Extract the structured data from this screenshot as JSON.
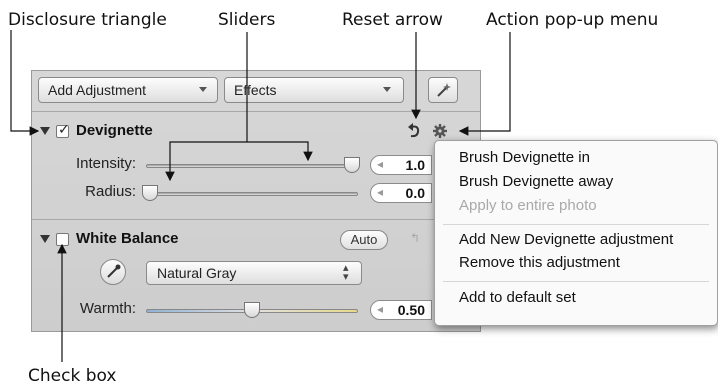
{
  "callouts": {
    "disclosure_triangle": "Disclosure triangle",
    "sliders": "Sliders",
    "reset_arrow": "Reset arrow",
    "action_popup_menu": "Action pop-up menu",
    "check_box": "Check box"
  },
  "toolbar": {
    "add_adjustment": "Add Adjustment",
    "effects": "Effects",
    "magic_icon": "wand-sparkle-icon"
  },
  "devignette": {
    "title": "Devignette",
    "checked": true,
    "intensity_label": "Intensity:",
    "intensity_value": "1.0",
    "intensity_level": 1.0,
    "radius_label": "Radius:",
    "radius_value": "0.0",
    "radius_level": 0.0,
    "reset_icon": "reset-arrow-icon",
    "action_icon": "gear-icon"
  },
  "white_balance": {
    "title": "White Balance",
    "checked": false,
    "auto_label": "Auto",
    "eyedropper_icon": "eyedropper-icon",
    "preset": "Natural Gray",
    "warmth_label": "Warmth:",
    "warmth_value": "0.50",
    "warmth_level": 0.5
  },
  "action_menu": {
    "items": [
      {
        "label": "Brush Devignette in",
        "enabled": true
      },
      {
        "label": "Brush Devignette away",
        "enabled": true
      },
      {
        "label": "Apply to entire photo",
        "enabled": false
      },
      {
        "label": "Add New Devignette adjustment",
        "enabled": true
      },
      {
        "label": "Remove this adjustment",
        "enabled": true
      },
      {
        "label": "Add to default set",
        "enabled": true
      }
    ]
  },
  "colors": {
    "panel_bg": "#d3d3d3",
    "menu_bg": "#fafafa",
    "disabled_text": "#a9a9a9"
  }
}
